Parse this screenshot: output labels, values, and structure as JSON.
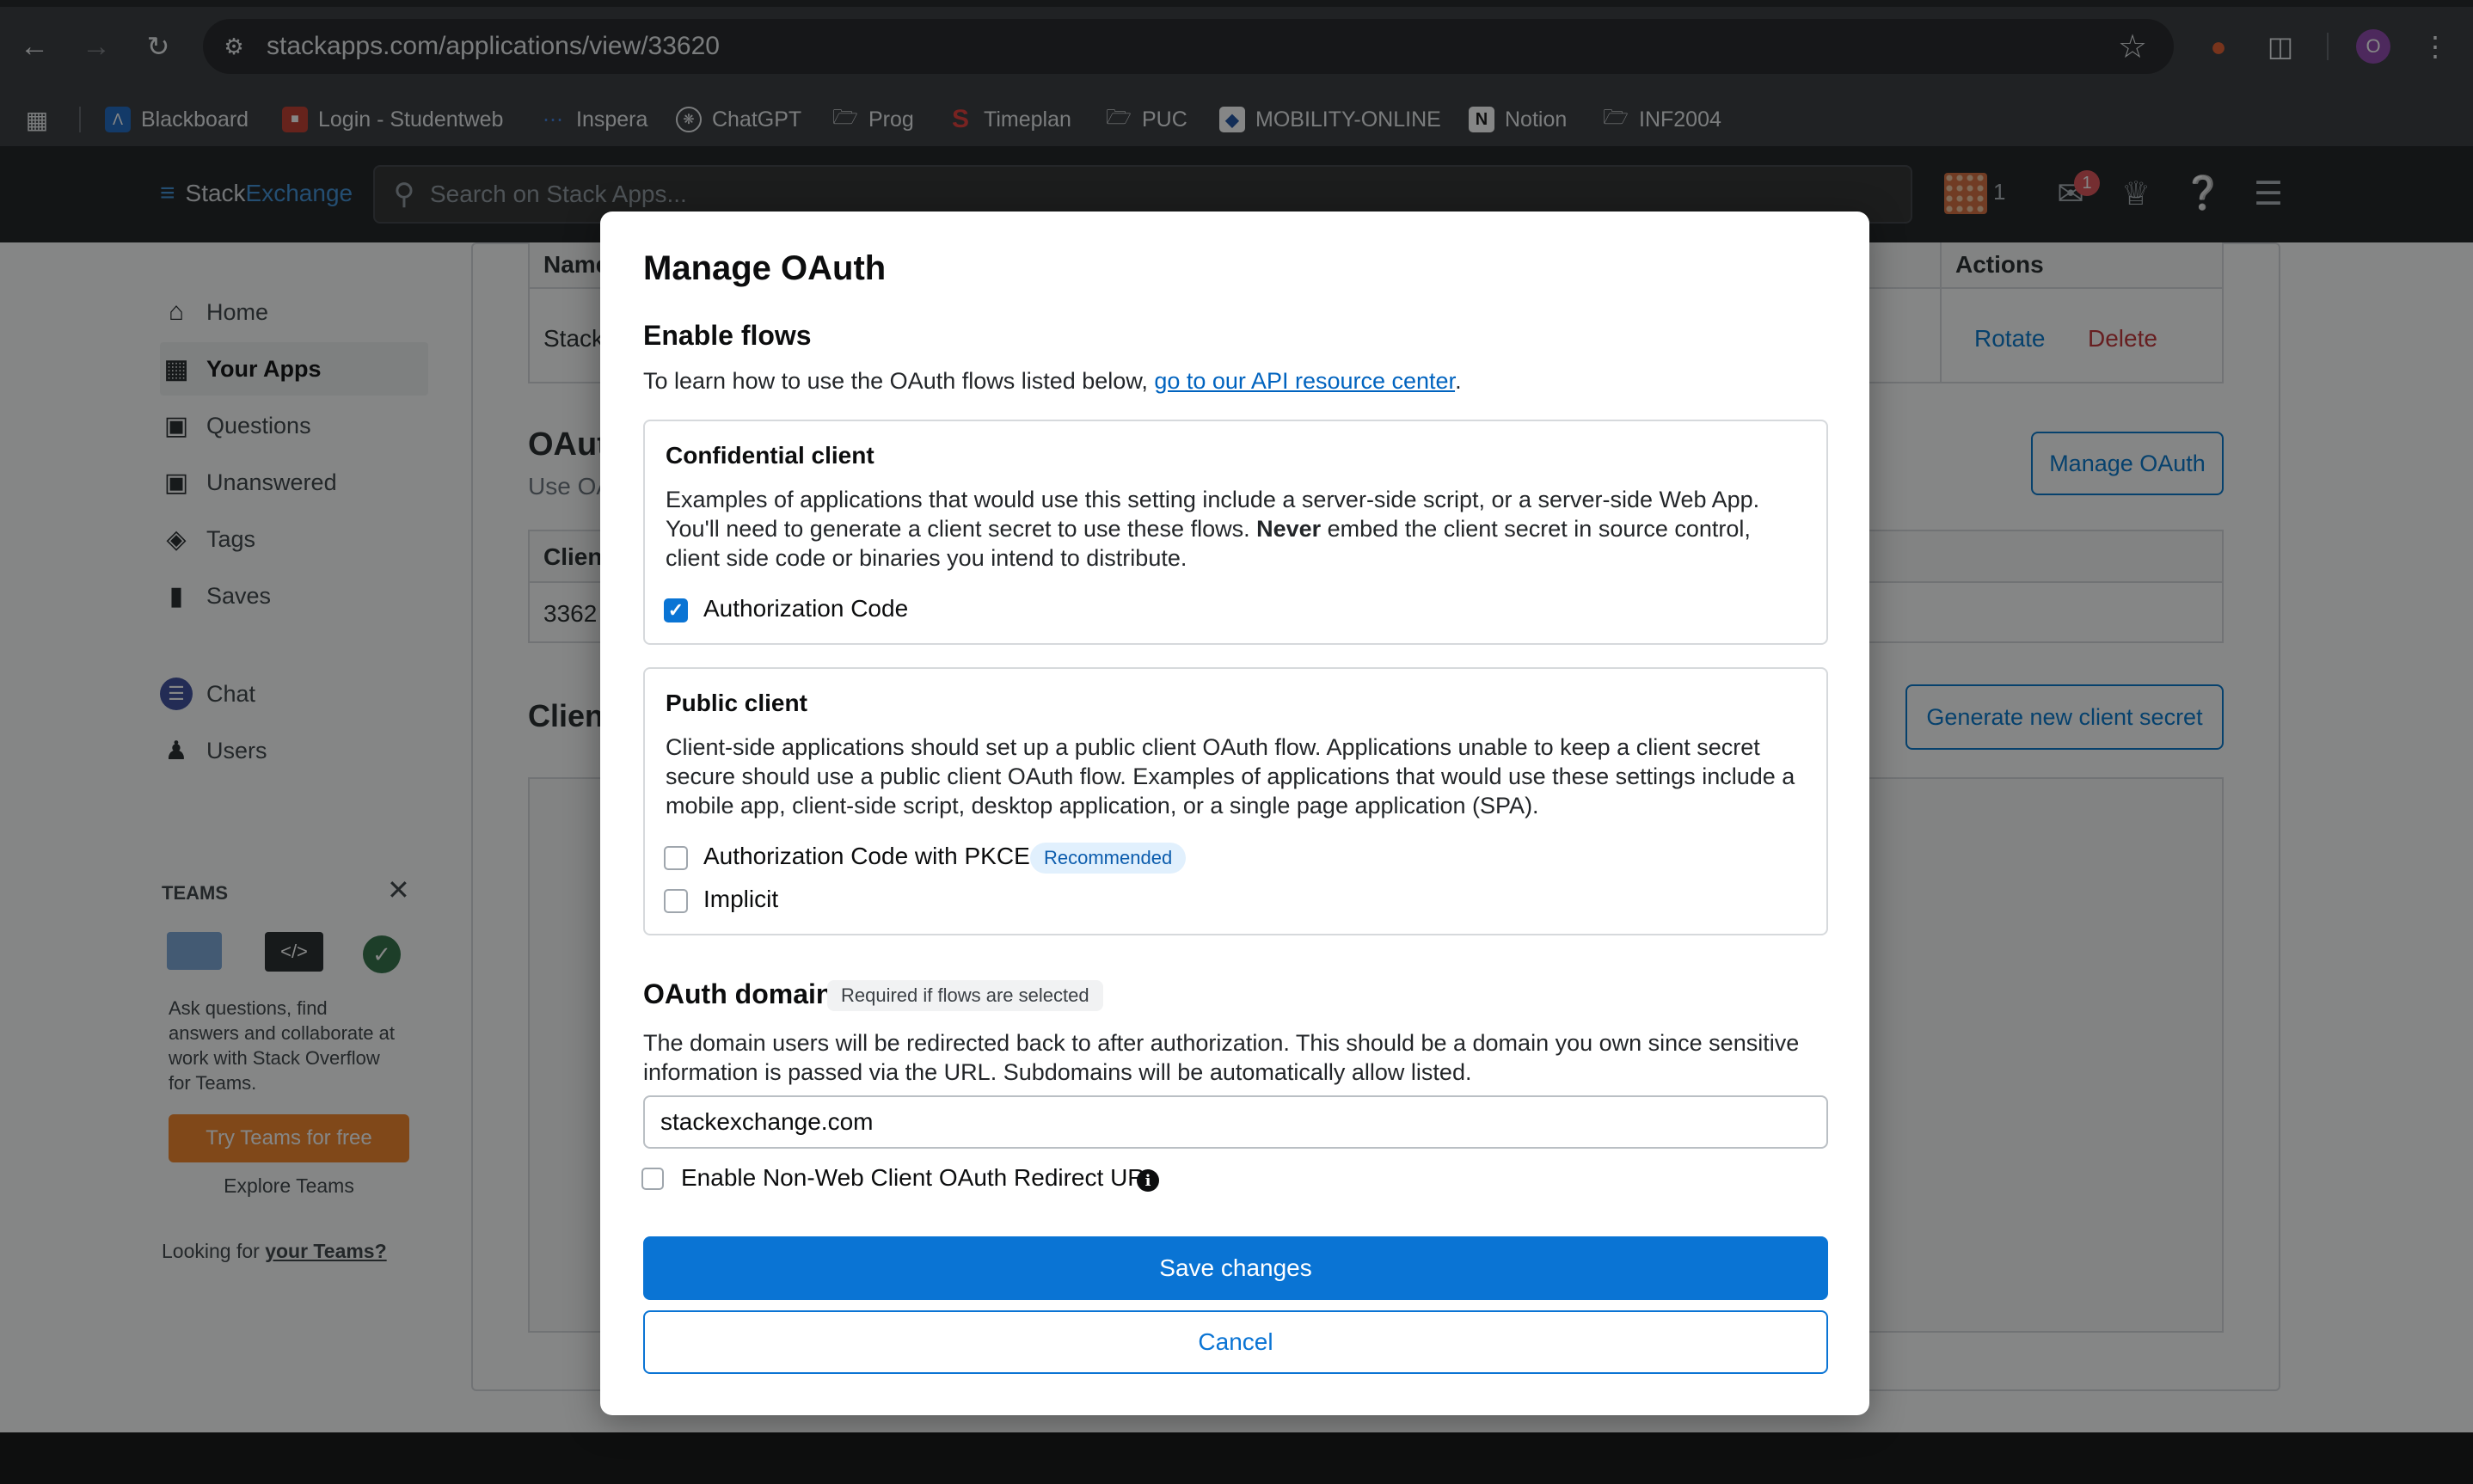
{
  "browser": {
    "url": "stackapps.com/applications/view/33620",
    "profile_initial": "O",
    "bookmarks": [
      {
        "label": "Blackboard",
        "icon": "blackboard-icon"
      },
      {
        "label": "Login - Studentweb",
        "icon": "studentweb-icon"
      },
      {
        "label": "Inspera",
        "icon": "inspera-icon"
      },
      {
        "label": "ChatGPT",
        "icon": "chatgpt-icon"
      },
      {
        "label": "Prog",
        "icon": "folder-icon"
      },
      {
        "label": "Timeplan",
        "icon": "timeplan-icon"
      },
      {
        "label": "PUC",
        "icon": "folder-icon"
      },
      {
        "label": "MOBILITY-ONLINE",
        "icon": "mobility-online-icon"
      },
      {
        "label": "Notion",
        "icon": "notion-icon"
      },
      {
        "label": "INF2004",
        "icon": "folder-icon"
      }
    ]
  },
  "site_header": {
    "logo_part1": "Stack",
    "logo_part2": "Exchange",
    "search_placeholder": "Search on Stack Apps...",
    "rep_count": "1",
    "inbox_badge": "1"
  },
  "sidebar": {
    "items": [
      {
        "label": "Home",
        "icon": "home-icon"
      },
      {
        "label": "Your Apps",
        "icon": "apps-icon"
      },
      {
        "label": "Questions",
        "icon": "questions-icon"
      },
      {
        "label": "Unanswered",
        "icon": "unanswered-icon"
      },
      {
        "label": "Tags",
        "icon": "tag-icon"
      },
      {
        "label": "Saves",
        "icon": "bookmark-icon"
      },
      {
        "label": "Chat",
        "icon": "chat-icon"
      },
      {
        "label": "Users",
        "icon": "users-icon"
      }
    ],
    "teams": {
      "heading": "TEAMS",
      "description": "Ask questions, find answers and collaborate at work with Stack Overflow for Teams.",
      "try_label": "Try Teams for free",
      "explore_label": "Explore Teams",
      "looking_prefix": "Looking for ",
      "looking_link": "your Teams?"
    }
  },
  "background_page": {
    "table_header_name": "Name",
    "table_header_actions": "Actions",
    "row_name_fragment": "Stack",
    "rotate_label": "Rotate",
    "delete_label": "Delete",
    "oauth_heading_fragment": "OAut",
    "oauth_sub_fragment": "Use OA",
    "manage_oauth_label": "Manage OAuth",
    "client_header_fragment": "Clien",
    "client_id_fragment": "3362",
    "client_secrets_fragment": "Client",
    "generate_secret_label": "Generate new client secret"
  },
  "modal": {
    "title": "Manage OAuth",
    "flows_heading": "Enable flows",
    "flows_intro_prefix": "To learn how to use the OAuth flows listed below, ",
    "flows_intro_link": "go to our API resource center",
    "flows_intro_suffix": ".",
    "confidential": {
      "heading": "Confidential client",
      "desc_part1": "Examples of applications that would use this setting include a server-side script, or a server-side Web App. You'll need to generate a client secret to use these flows. ",
      "desc_bold": "Never",
      "desc_part2": " embed the client secret in source control, client side code or binaries you intend to distribute.",
      "options": [
        {
          "label": "Authorization Code",
          "checked": true
        }
      ]
    },
    "public": {
      "heading": "Public client",
      "desc": "Client-side applications should set up a public client OAuth flow. Applications unable to keep a client secret secure should use a public client OAuth flow. Examples of applications that would use these settings include a mobile app, client-side script, desktop application, or a single page application (SPA).",
      "options": [
        {
          "label": "Authorization Code with PKCE",
          "checked": false,
          "badge": "Recommended"
        },
        {
          "label": "Implicit",
          "checked": false
        }
      ]
    },
    "domain": {
      "heading": "OAuth domain",
      "required_badge": "Required if flows are selected",
      "desc": "The domain users will be redirected back to after authorization. This should be a domain you own since sensitive information is passed via the URL. Subdomains will be automatically allow listed.",
      "value": "stackexchange.com",
      "non_web_label": "Enable Non-Web Client OAuth Redirect URI"
    },
    "save_label": "Save changes",
    "cancel_label": "Cancel"
  }
}
